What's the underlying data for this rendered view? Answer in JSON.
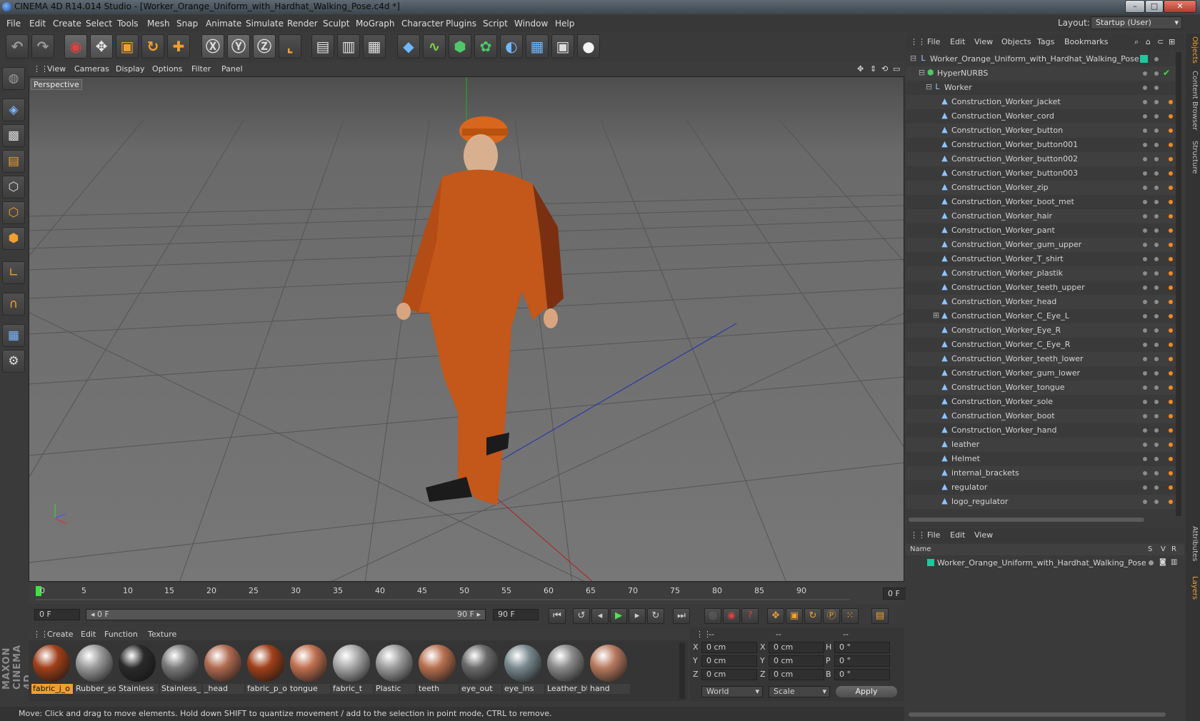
{
  "window": {
    "title": "CINEMA 4D R14.014 Studio - [Worker_Orange_Uniform_with_Hardhat_Walking_Pose.c4d *]",
    "min": "–",
    "max": "□",
    "close": "✕"
  },
  "menu": [
    "File",
    "Edit",
    "Create",
    "Select",
    "Tools",
    "Mesh",
    "Snap",
    "Animate",
    "Simulate",
    "Render",
    "Sculpt",
    "MoGraph",
    "Character",
    "Plugins",
    "Script",
    "Window",
    "Help"
  ],
  "layout": {
    "label": "Layout:",
    "value": "Startup (User)"
  },
  "viewport": {
    "menu": [
      "View",
      "Cameras",
      "Display",
      "Options",
      "Filter",
      "Panel"
    ],
    "label": "Perspective"
  },
  "timeline": {
    "ticks": [
      "0",
      "5",
      "10",
      "15",
      "20",
      "25",
      "30",
      "35",
      "40",
      "45",
      "50",
      "55",
      "60",
      "65",
      "70",
      "75",
      "80",
      "85",
      "90"
    ],
    "frame_end_field": "0 F",
    "current_frame": "0 F",
    "range_start": "◂ 0 F",
    "range_end": "90 F ▸",
    "max_frame": "90 F"
  },
  "materials": {
    "menu": [
      "Create",
      "Edit",
      "Function",
      "Texture"
    ],
    "items": [
      {
        "label": "fabric_j_o",
        "color": "#a0401a"
      },
      {
        "label": "Rubber_so",
        "color": "#9a9a9a"
      },
      {
        "label": "Stainless",
        "color": "#2a2a2a"
      },
      {
        "label": "Stainless_",
        "color": "#7a7a7a"
      },
      {
        "label": "_head",
        "color": "#b06a50"
      },
      {
        "label": "fabric_p_o",
        "color": "#a0401a"
      },
      {
        "label": "tongue",
        "color": "#c07050"
      },
      {
        "label": "fabric_t",
        "color": "#a8a8a8"
      },
      {
        "label": "Plastic",
        "color": "#9d9d9d"
      },
      {
        "label": "teeth",
        "color": "#b87050"
      },
      {
        "label": "eye_out",
        "color": "#6a6a6a"
      },
      {
        "label": "eye_ins",
        "color": "#7a8a90"
      },
      {
        "label": "Leather_bt",
        "color": "#8a8a8a"
      },
      {
        "label": "hand",
        "color": "#b87a60"
      }
    ]
  },
  "coords": {
    "headers": [
      "--",
      "--",
      "--"
    ],
    "rows": [
      {
        "a": "X",
        "av": "0 cm",
        "b": "X",
        "bv": "0 cm",
        "c": "H",
        "cv": "0 °"
      },
      {
        "a": "Y",
        "av": "0 cm",
        "b": "Y",
        "bv": "0 cm",
        "c": "P",
        "cv": "0 °"
      },
      {
        "a": "Z",
        "av": "0 cm",
        "b": "Z",
        "bv": "0 cm",
        "c": "B",
        "cv": "0 °"
      }
    ],
    "world": "World",
    "scale": "Scale",
    "apply": "Apply"
  },
  "status": "Move: Click and drag to move elements. Hold down SHIFT to quantize movement / add to the selection in point mode, CTRL to remove.",
  "objects": {
    "menu": [
      "File",
      "Edit",
      "View",
      "Objects",
      "Tags",
      "Bookmarks"
    ],
    "root": "Worker_Orange_Uniform_with_Hardhat_Walking_Pose",
    "hypernurbs": "HyperNURBS",
    "group": "Worker",
    "items": [
      "Construction_Worker_jacket",
      "Construction_Worker_cord",
      "Construction_Worker_button",
      "Construction_Worker_button001",
      "Construction_Worker_button002",
      "Construction_Worker_button003",
      "Construction_Worker_zip",
      "Construction_Worker_boot_met",
      "Construction_Worker_hair",
      "Construction_Worker_pant",
      "Construction_Worker_gum_upper",
      "Construction_Worker_T_shirt",
      "Construction_Worker_plastik",
      "Construction_Worker_teeth_upper",
      "Construction_Worker_head",
      "Construction_Worker_C_Eye_L",
      "Construction_Worker_Eye_R",
      "Construction_Worker_C_Eye_R",
      "Construction_Worker_teeth_lower",
      "Construction_Worker_gum_lower",
      "Construction_Worker_tongue",
      "Construction_Worker_sole",
      "Construction_Worker_boot",
      "Construction_Worker_hand",
      "leather",
      "Helmet",
      "internal_brackets",
      "regulator",
      "logo_regulator"
    ]
  },
  "layers": {
    "menu": [
      "File",
      "Edit",
      "View"
    ],
    "col_name": "Name",
    "col_s": "S",
    "col_v": "V",
    "col_r": "R",
    "row": "Worker_Orange_Uniform_with_Hardhat_Walking_Pose"
  },
  "side_tabs": [
    "Objects",
    "Content Browser",
    "Structure",
    "Attributes",
    "Layers"
  ],
  "brand": "MAXON CINEMA 4D"
}
